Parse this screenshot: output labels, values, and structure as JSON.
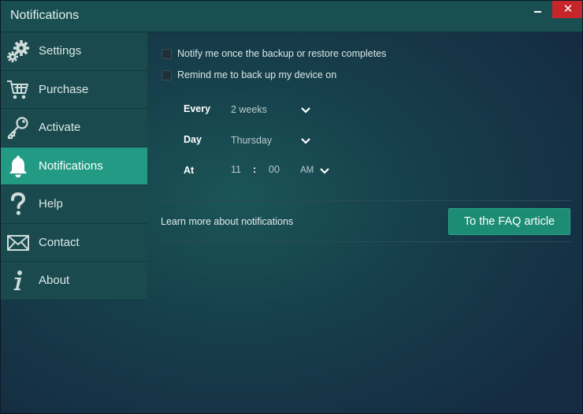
{
  "window": {
    "title": "Notifications",
    "close_glyph": "✕"
  },
  "sidebar": {
    "items": [
      {
        "label": "Settings",
        "icon": "gears-icon",
        "active": false
      },
      {
        "label": "Purchase",
        "icon": "cart-icon",
        "active": false
      },
      {
        "label": "Activate",
        "icon": "key-icon",
        "active": false
      },
      {
        "label": "Notifications",
        "icon": "bell-icon",
        "active": true
      },
      {
        "label": "Help",
        "icon": "question-icon",
        "active": false
      },
      {
        "label": "Contact",
        "icon": "envelope-icon",
        "active": false
      },
      {
        "label": "About",
        "icon": "info-icon",
        "active": false
      }
    ]
  },
  "main": {
    "notify_complete": {
      "label": "Notify me once the backup or restore completes",
      "checked": false
    },
    "remind_backup": {
      "label": "Remind me to back up my device on",
      "checked": false
    },
    "schedule": {
      "every": {
        "label": "Every",
        "value": "2 weeks"
      },
      "day": {
        "label": "Day",
        "value": "Thursday"
      },
      "at": {
        "label": "At",
        "hour": "11",
        "separator": ":",
        "minute": "00",
        "ampm": "AM"
      }
    },
    "learn_more": "Learn more about notifications",
    "faq_button": "To the FAQ article"
  },
  "colors": {
    "accent": "#239a84",
    "button": "#1d8c74",
    "close": "#c6262b",
    "sidebar": "#1a4a4d"
  }
}
